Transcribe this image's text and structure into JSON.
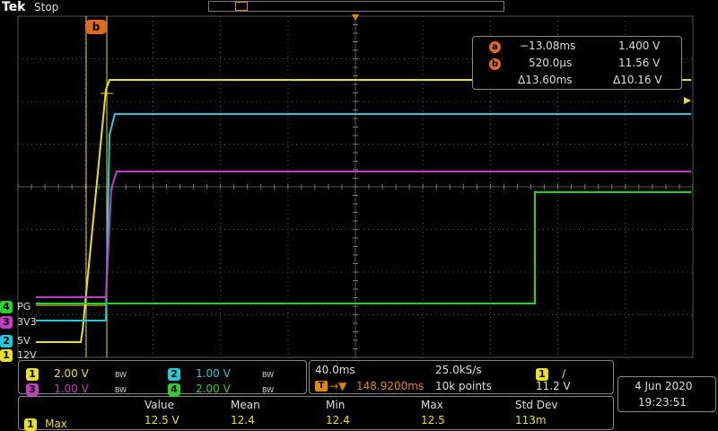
{
  "header": {
    "brand": "Tek",
    "status": "Stop"
  },
  "cursor_readout": {
    "cursor_a_letter": "a",
    "cursor_a_time": "−13.08ms",
    "cursor_a_volt": "1.400 V",
    "cursor_b_letter": "b",
    "cursor_b_time": "520.0µs",
    "cursor_b_volt": "11.56 V",
    "delta_time": "Δ13.60ms",
    "delta_volt": "Δ10.16 V",
    "tag_label": "b"
  },
  "channel_labels": {
    "ch4": {
      "num": "4",
      "label": "PG",
      "color": "#2ad02a"
    },
    "ch3": {
      "num": "3",
      "label": "3V3",
      "color": "#c040c0"
    },
    "ch2": {
      "num": "2",
      "label": "5V",
      "color": "#28c8d8"
    },
    "ch1": {
      "num": "1",
      "label": "12V",
      "color": "#e8e020"
    }
  },
  "vertical": {
    "ch1": {
      "num": "1",
      "scale": "2.00 V",
      "bw": "BW"
    },
    "ch2": {
      "num": "2",
      "scale": "1.00 V",
      "bw": "BW"
    },
    "ch3": {
      "num": "3",
      "scale": "1.00 V",
      "bw": "BW"
    },
    "ch4": {
      "num": "4",
      "scale": "2.00 V",
      "bw": "BW"
    }
  },
  "horizontal": {
    "timebase": "40.0ms",
    "sample_rate": "25.0kS/s",
    "trigger_pos": "148.9200ms",
    "record_length": "10k points",
    "trig_tag": "T"
  },
  "trigger": {
    "source": "1",
    "slope": "∕",
    "level": "11.2 V"
  },
  "datetime": {
    "date": "4 Jun  2020",
    "time": "19:23:51"
  },
  "measurement": {
    "headers": [
      "Value",
      "Mean",
      "Min",
      "Max",
      "Std Dev"
    ],
    "channel": "1",
    "name": "Max",
    "values": [
      "12.5 V",
      "12.4",
      "12.4",
      "12.5",
      "113m"
    ]
  },
  "colors": {
    "ch1": "#e8e020",
    "ch2": "#28c8d8",
    "ch3": "#c040c0",
    "ch4": "#2ad02a",
    "cursor": "#e06a1e",
    "trigger": "#e08a00"
  }
}
